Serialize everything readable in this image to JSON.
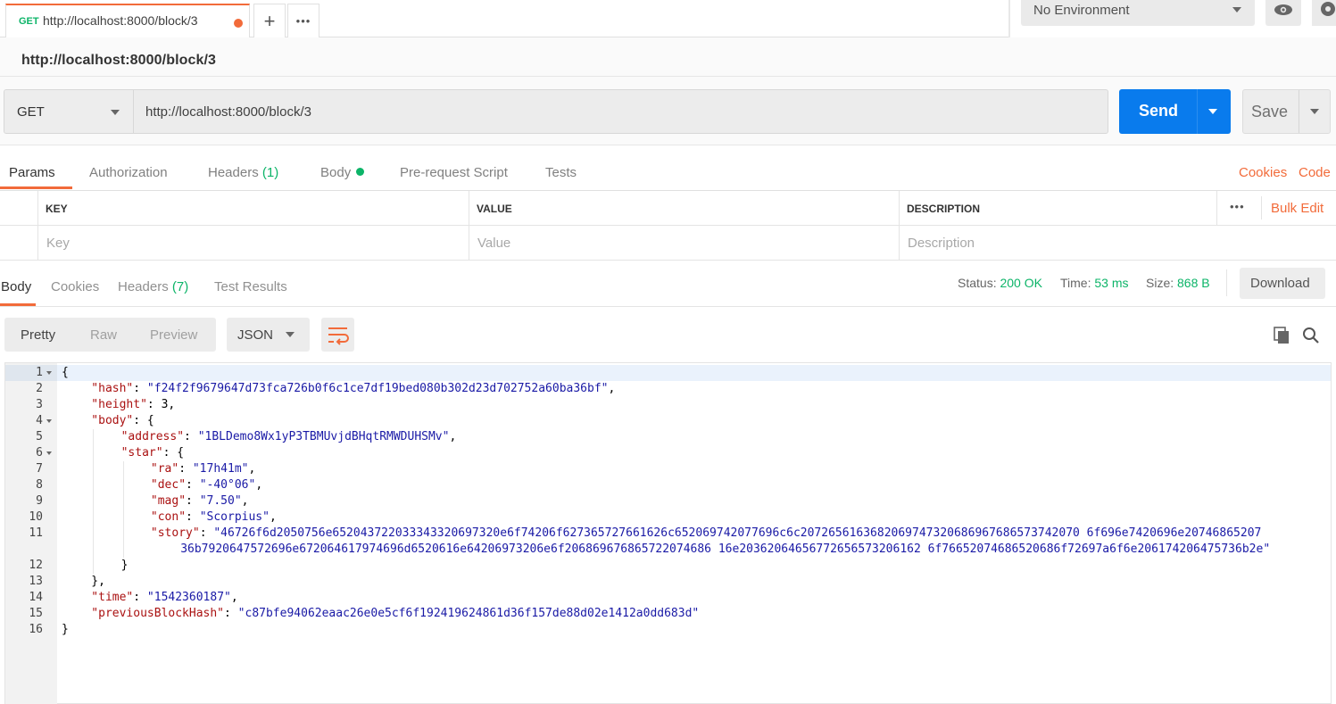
{
  "tab": {
    "method": "GET",
    "url": "http://localhost:8000/block/3",
    "add": "+",
    "more": "•••"
  },
  "environment": {
    "selected": "No Environment"
  },
  "request_name": "http://localhost:8000/block/3",
  "request": {
    "method": "GET",
    "url": "http://localhost:8000/block/3",
    "send_label": "Send",
    "save_label": "Save"
  },
  "request_tabs": {
    "params": "Params",
    "authorization": "Authorization",
    "headers": "Headers",
    "headers_count": "(1)",
    "body": "Body",
    "prerequest": "Pre-request Script",
    "tests": "Tests",
    "cookies": "Cookies",
    "code": "Code"
  },
  "params_table": {
    "headers": [
      "KEY",
      "VALUE",
      "DESCRIPTION"
    ],
    "more": "•••",
    "bulk_edit": "Bulk Edit",
    "placeholders": [
      "Key",
      "Value",
      "Description"
    ]
  },
  "response_tabs": {
    "body": "Body",
    "cookies": "Cookies",
    "headers": "Headers",
    "headers_count": "(7)",
    "test_results": "Test Results"
  },
  "response_meta": {
    "status_label": "Status:",
    "status": "200 OK",
    "time_label": "Time:",
    "time": "53 ms",
    "size_label": "Size:",
    "size": "868 B",
    "download": "Download"
  },
  "format": {
    "pretty": "Pretty",
    "raw": "Raw",
    "preview": "Preview",
    "language": "JSON"
  },
  "code_lines": [
    {
      "n": "1",
      "indent": 0,
      "parts": [
        [
          "p",
          "{"
        ]
      ],
      "fold": true
    },
    {
      "n": "2",
      "indent": 1,
      "parts": [
        [
          "k",
          "\"hash\""
        ],
        [
          "p",
          ": "
        ],
        [
          "s",
          "\"f24f2f9679647d73fca726b0f6c1ce7df19bed080b302d23d702752a60ba36bf\""
        ],
        [
          "p",
          ","
        ]
      ]
    },
    {
      "n": "3",
      "indent": 1,
      "parts": [
        [
          "k",
          "\"height\""
        ],
        [
          "p",
          ": 3,"
        ]
      ]
    },
    {
      "n": "4",
      "indent": 1,
      "parts": [
        [
          "k",
          "\"body\""
        ],
        [
          "p",
          ": {"
        ]
      ],
      "fold": true
    },
    {
      "n": "5",
      "indent": 2,
      "parts": [
        [
          "k",
          "\"address\""
        ],
        [
          "p",
          ": "
        ],
        [
          "s",
          "\"1BLDemo8Wx1yP3TBMUvjdBHqtRMWDUHSMv\""
        ],
        [
          "p",
          ","
        ]
      ]
    },
    {
      "n": "6",
      "indent": 2,
      "parts": [
        [
          "k",
          "\"star\""
        ],
        [
          "p",
          ": {"
        ]
      ],
      "fold": true
    },
    {
      "n": "7",
      "indent": 3,
      "parts": [
        [
          "k",
          "\"ra\""
        ],
        [
          "p",
          ": "
        ],
        [
          "s",
          "\"17h41m\""
        ],
        [
          "p",
          ","
        ]
      ]
    },
    {
      "n": "8",
      "indent": 3,
      "parts": [
        [
          "k",
          "\"dec\""
        ],
        [
          "p",
          ": "
        ],
        [
          "s",
          "\"-40°06\""
        ],
        [
          "p",
          ","
        ]
      ]
    },
    {
      "n": "9",
      "indent": 3,
      "parts": [
        [
          "k",
          "\"mag\""
        ],
        [
          "p",
          ": "
        ],
        [
          "s",
          "\"7.50\""
        ],
        [
          "p",
          ","
        ]
      ]
    },
    {
      "n": "10",
      "indent": 3,
      "parts": [
        [
          "k",
          "\"con\""
        ],
        [
          "p",
          ": "
        ],
        [
          "s",
          "\"Scorpius\""
        ],
        [
          "p",
          ","
        ]
      ]
    },
    {
      "n": "11",
      "indent": 3,
      "parts": [
        [
          "k",
          "\"story\""
        ],
        [
          "p",
          ": "
        ],
        [
          "s",
          "\"46726f6d2050756e652043722033343320697320e6f74206f627365727661626c652069742077696c6c2072656163682069747320686967686573742070 6f696e7420696e20746865207"
        ]
      ]
    },
    {
      "n": "",
      "indent": 4,
      "wrap": true,
      "parts": [
        [
          "s",
          "36b7920647572696e672064617974696d6520616e64206973206e6f206869676865722074686 16e20362064656772656573206162 6f76652074686520686f72697a6f6e206174206475736b2e\""
        ]
      ]
    },
    {
      "n": "12",
      "indent": 2,
      "parts": [
        [
          "p",
          "}"
        ]
      ]
    },
    {
      "n": "13",
      "indent": 1,
      "parts": [
        [
          "p",
          "},"
        ]
      ]
    },
    {
      "n": "14",
      "indent": 1,
      "parts": [
        [
          "k",
          "\"time\""
        ],
        [
          "p",
          ": "
        ],
        [
          "s",
          "\"1542360187\""
        ],
        [
          "p",
          ","
        ]
      ]
    },
    {
      "n": "15",
      "indent": 1,
      "parts": [
        [
          "k",
          "\"previousBlockHash\""
        ],
        [
          "p",
          ": "
        ],
        [
          "s",
          "\"c87bfe94062eaac26e0e5cf6f192419624861d36f157de88d02e1412a0dd683d\""
        ]
      ]
    },
    {
      "n": "16",
      "indent": 0,
      "parts": [
        [
          "p",
          "}"
        ]
      ]
    }
  ]
}
